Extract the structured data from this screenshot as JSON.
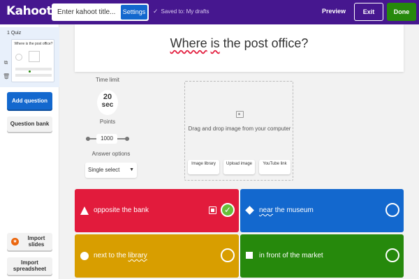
{
  "topbar": {
    "logo": "Kahoot!",
    "title_placeholder": "Enter kahoot title...",
    "settings_label": "Settings",
    "saved_text": "Saved to: My drafts",
    "preview_label": "Preview",
    "exit_label": "Exit",
    "done_label": "Done"
  },
  "sidebar": {
    "slide_label": "1  Quiz",
    "thumb_question": "Where is the post office?",
    "add_question_label": "Add question",
    "question_bank_label": "Question bank",
    "import_slides_label": "Import slides",
    "import_spreadsheet_label": "Import spreadsheet"
  },
  "question": {
    "text_underlined": "Where",
    "text_middle": " ",
    "text_underlined2": "is",
    "text_rest": " the post office?"
  },
  "settings": {
    "time_limit_label": "Time limit",
    "time_value": "20",
    "time_unit": "sec",
    "points_label": "Points",
    "points_value": "1000",
    "answer_options_label": "Answer options",
    "answer_type": "Single select"
  },
  "media": {
    "drop_text": "Drag and drop image from your computer",
    "image_library_label": "Image library",
    "upload_image_label": "Upload image",
    "youtube_link_label": "YouTube link"
  },
  "answers": [
    {
      "text": "opposite the bank",
      "shape": "triangle",
      "color": "#e21b3c",
      "correct": true
    },
    {
      "text_underlined": "near",
      "text_rest": " the museum",
      "shape": "diamond",
      "color": "#1368ce",
      "correct": false
    },
    {
      "text_pre": "next to the ",
      "text_underlined": "library",
      "shape": "circle",
      "color": "#d89e00",
      "correct": false
    },
    {
      "text": "in front of the market",
      "shape": "square",
      "color": "#26890c",
      "correct": false
    }
  ],
  "colors": {
    "brand_purple": "#46178f",
    "primary_blue": "#1368ce",
    "done_green": "#26890c",
    "answer_red": "#e21b3c",
    "answer_blue": "#1368ce",
    "answer_yellow": "#d89e00",
    "answer_green": "#26890c"
  }
}
